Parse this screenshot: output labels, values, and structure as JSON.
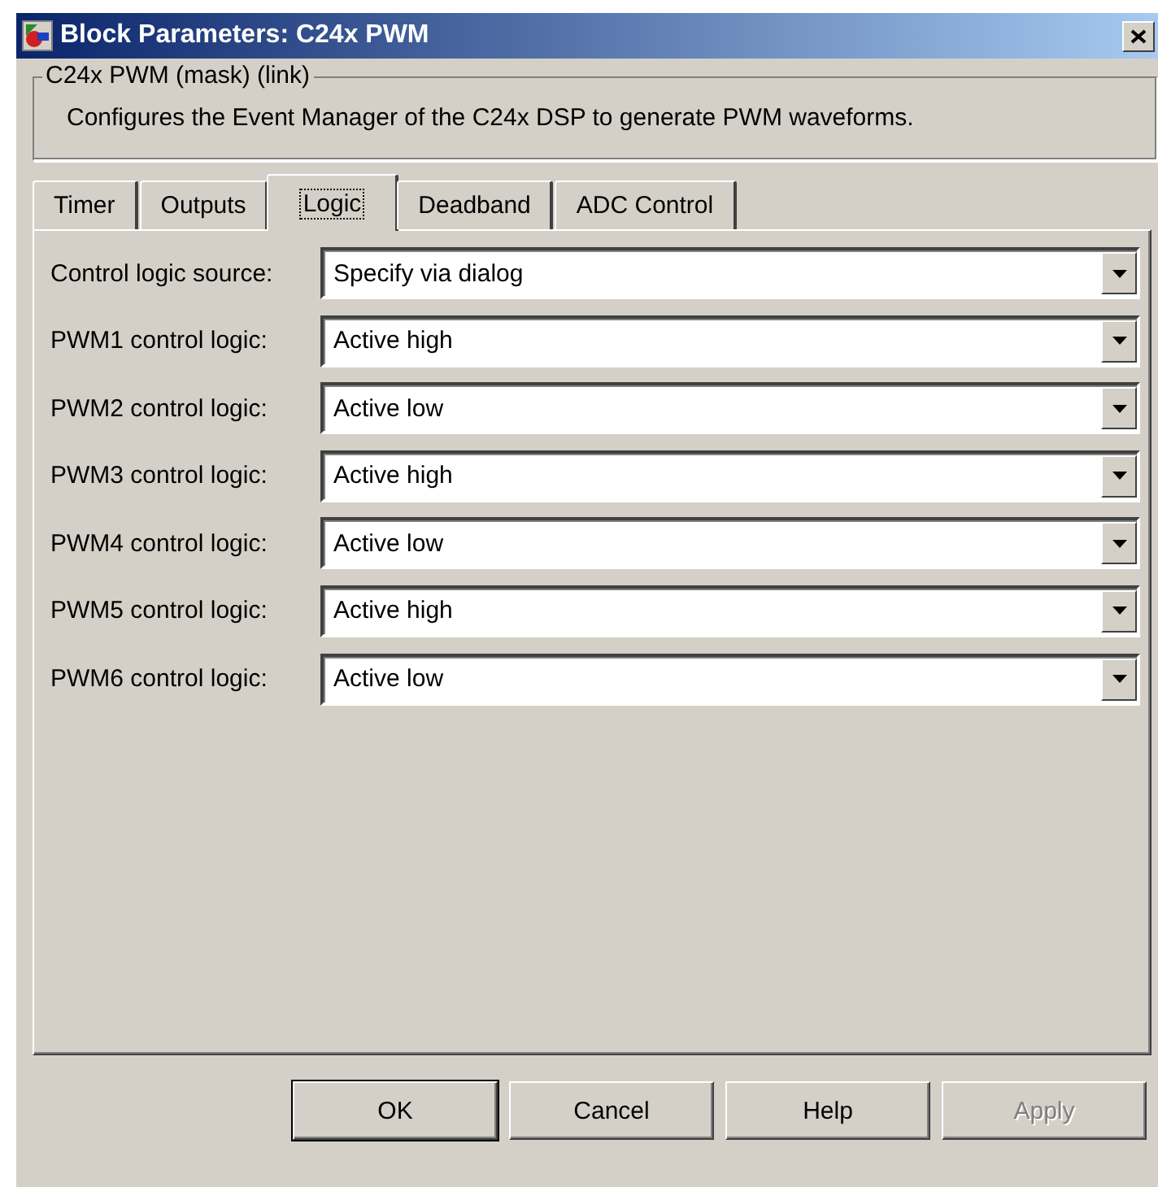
{
  "window": {
    "title": "Block Parameters: C24x PWM"
  },
  "group": {
    "title": "C24x PWM (mask) (link)",
    "description": "Configures the Event Manager of the C24x DSP to generate PWM waveforms."
  },
  "tabs": [
    {
      "label": "Timer",
      "selected": false
    },
    {
      "label": "Outputs",
      "selected": false
    },
    {
      "label": "Logic",
      "selected": true
    },
    {
      "label": "Deadband",
      "selected": false
    },
    {
      "label": "ADC Control",
      "selected": false
    }
  ],
  "fields": [
    {
      "label": "Control logic source:",
      "value": "Specify via dialog"
    },
    {
      "label": "PWM1 control logic:",
      "value": "Active high"
    },
    {
      "label": "PWM2 control logic:",
      "value": "Active low"
    },
    {
      "label": "PWM3 control logic:",
      "value": "Active high"
    },
    {
      "label": "PWM4 control logic:",
      "value": "Active low"
    },
    {
      "label": "PWM5 control logic:",
      "value": "Active high"
    },
    {
      "label": "PWM6 control logic:",
      "value": "Active low"
    }
  ],
  "buttons": [
    {
      "label": "OK",
      "default": true,
      "disabled": false
    },
    {
      "label": "Cancel",
      "default": false,
      "disabled": false
    },
    {
      "label": "Help",
      "default": false,
      "disabled": false
    },
    {
      "label": "Apply",
      "default": false,
      "disabled": true
    }
  ]
}
